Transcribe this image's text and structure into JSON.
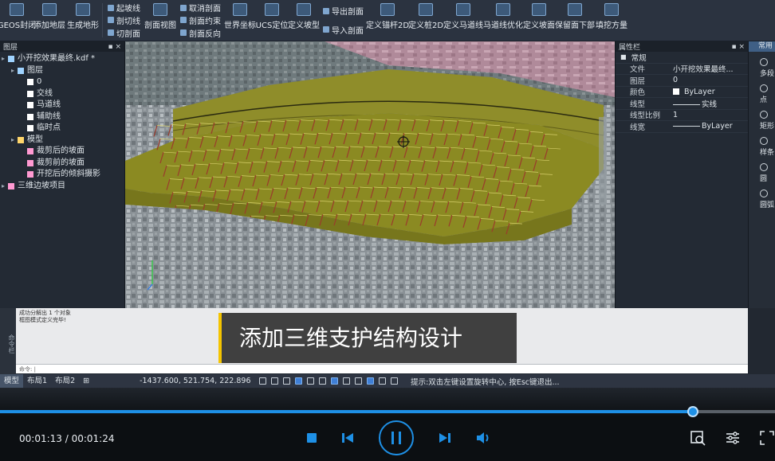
{
  "ribbon": {
    "b1": "GEOS封闭",
    "b2": "添加地层",
    "b3": "生成地形",
    "s1": [
      "起坡线",
      "剖切线",
      "切剖面"
    ],
    "b4": "剖面视图",
    "s2": [
      "取消剖面",
      "剖面约束",
      "剖面反向"
    ],
    "b5": "世界坐标",
    "b6": "UCS定位",
    "b7": "定义坡型",
    "s3": [
      "导出剖面",
      "导入剖面"
    ],
    "b8": "定义锚杆2D",
    "b9": "定义桩2D",
    "b10": "定义马道线",
    "b11": "马道线优化",
    "b12": "定义坡面",
    "b13": "保留面下部",
    "b14": "填挖方量"
  },
  "layer_panel": {
    "title": "图层",
    "pin": "▪ ×",
    "items": [
      {
        "label": "小开挖效果最终.kdf *",
        "indent": 0,
        "color": "#9fd3ff"
      },
      {
        "label": "图层",
        "indent": 1,
        "color": "#9fd3ff"
      },
      {
        "label": "0",
        "indent": 2,
        "color": "#ffffff"
      },
      {
        "label": "交线",
        "indent": 2,
        "color": "#ffffff"
      },
      {
        "label": "马道线",
        "indent": 2,
        "color": "#ffffff"
      },
      {
        "label": "辅助线",
        "indent": 2,
        "color": "#ffffff"
      },
      {
        "label": "临时点",
        "indent": 2,
        "color": "#ffffff"
      },
      {
        "label": "模型",
        "indent": 1,
        "color": "#ffd66b"
      },
      {
        "label": "裁剪后的坡面",
        "indent": 2,
        "color": "#ff9ad2"
      },
      {
        "label": "裁剪前的坡面",
        "indent": 2,
        "color": "#ff9ad2"
      },
      {
        "label": "开挖后的倾斜摄影",
        "indent": 2,
        "color": "#ff9ad2"
      },
      {
        "label": "三维边坡项目",
        "indent": 0,
        "color": "#ff9ad2"
      }
    ]
  },
  "properties": {
    "title": "属性栏",
    "pin": "▪ ×",
    "section": "常规",
    "rows": [
      {
        "k": "文件",
        "v": "小开挖效果最终..."
      },
      {
        "k": "图层",
        "v": "0"
      },
      {
        "k": "颜色",
        "v": "ByLayer"
      },
      {
        "k": "线型",
        "v": "实线"
      },
      {
        "k": "线型比例",
        "v": "1"
      },
      {
        "k": "线宽",
        "v": "ByLayer"
      }
    ]
  },
  "palette": {
    "title": "常用",
    "items": [
      "多段",
      "点",
      "矩形",
      "样条",
      "圆",
      "圆弧"
    ]
  },
  "command": {
    "side": "命令栏",
    "history": [
      "成功分解出 1 个对象",
      "框图模式定义完毕!"
    ],
    "prompt": "命令:"
  },
  "caption": "添加三维支护结构设计",
  "status": {
    "tabs": [
      "模型",
      "布局1",
      "布局2",
      "⊞"
    ],
    "coords": "-1437.600, 521.754, 222.896",
    "hint": "提示:双击左键设置旋转中心, 按Esc键退出..."
  },
  "video": {
    "time": "00:01:13 / 00:01:24",
    "progress": 0.894,
    "accent": "#1e90e6"
  }
}
